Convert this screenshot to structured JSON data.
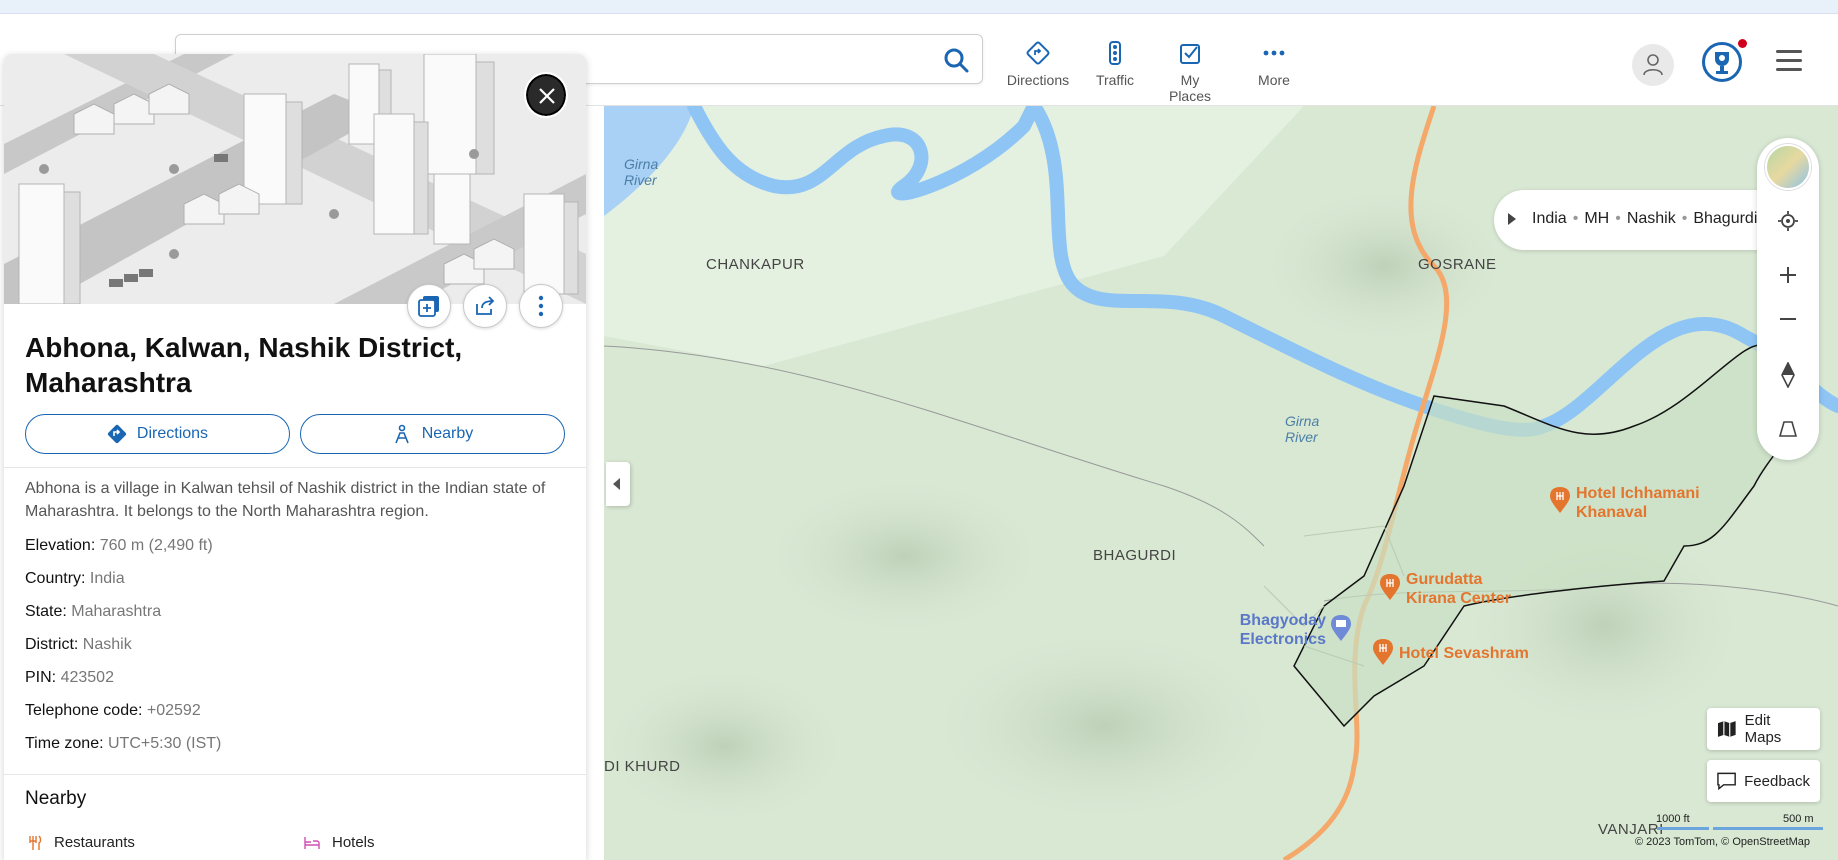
{
  "header": {
    "nav": [
      {
        "label": "Directions",
        "icon": "directions-icon"
      },
      {
        "label": "Traffic",
        "icon": "traffic-light-icon"
      },
      {
        "label": "My Places",
        "icon": "my-places-icon"
      },
      {
        "label": "More",
        "icon": "more-dots-icon"
      }
    ]
  },
  "panel": {
    "title": "Abhona, Kalwan, Nashik District, Maharashtra",
    "directions_label": "Directions",
    "nearby_label": "Nearby",
    "description": "Abhona is a village in Kalwan tehsil of Nashik district in the Indian state of Maharashtra. It belongs to the North Maharashtra region.",
    "facts": [
      {
        "key": "Elevation:",
        "value": "760 m (2,490 ft)"
      },
      {
        "key": "Country:",
        "value": "India"
      },
      {
        "key": "State:",
        "value": "Maharashtra"
      },
      {
        "key": "District:",
        "value": "Nashik"
      },
      {
        "key": "PIN:",
        "value": "423502"
      },
      {
        "key": "Telephone code:",
        "value": "+02592"
      },
      {
        "key": "Time zone:",
        "value": "UTC+5:30 (IST)"
      }
    ],
    "nearby_title": "Nearby",
    "nearby_items": [
      "Restaurants",
      "Hotels"
    ]
  },
  "map": {
    "breadcrumb": [
      "India",
      "MH",
      "Nashik",
      "Bhagurdi"
    ],
    "labels": {
      "chankapur": "CHANKAPUR",
      "gosrane": "GOSRANE",
      "bhagurdi": "BHAGURDI",
      "di_khurd": "DI KHURD",
      "vanjari": "VANJARI"
    },
    "rivers": {
      "river1_line1": "Girna",
      "river1_line2": "River",
      "river2_line1": "Girna",
      "river2_line2": "River"
    },
    "pois": {
      "hotel_ichhamani_1": "Hotel Ichhamani",
      "hotel_ichhamani_2": "Khanaval",
      "gurudatta_1": "Gurudatta",
      "gurudatta_2": "Kirana Center",
      "bhagyoday_1": "Bhagyoday",
      "bhagyoday_2": "Electronics",
      "sevashram": "Hotel Sevashram"
    },
    "edit_maps": "Edit Maps",
    "feedback": "Feedback",
    "scale_ft": "1000 ft",
    "scale_m": "500 m",
    "copyright": "© 2023 TomTom, © OpenStreetMap"
  },
  "colors": {
    "accent": "#1a66b3",
    "poi": "#e4752e",
    "river": "#8ec5f4",
    "road": "#f4a86a"
  }
}
